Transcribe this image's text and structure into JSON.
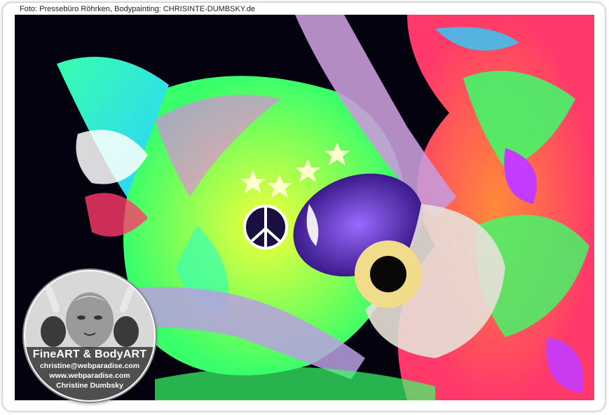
{
  "credit": "Foto: Pressebüro Röhrken, Bodypainting: CHRISINTE-DUMBSKY.de",
  "badge": {
    "title": "FineART & BodyART",
    "email": "christine@webparadise.com",
    "website": "www.webparadise.com",
    "name": "Christine Dumbsky"
  },
  "colors": {
    "neon_green": "#39ff6a",
    "neon_orange": "#ff6a2a",
    "neon_magenta": "#c43cff",
    "neon_yellow": "#f4ff3a",
    "deep_purple": "#3a1a8a",
    "background": "#050210"
  }
}
